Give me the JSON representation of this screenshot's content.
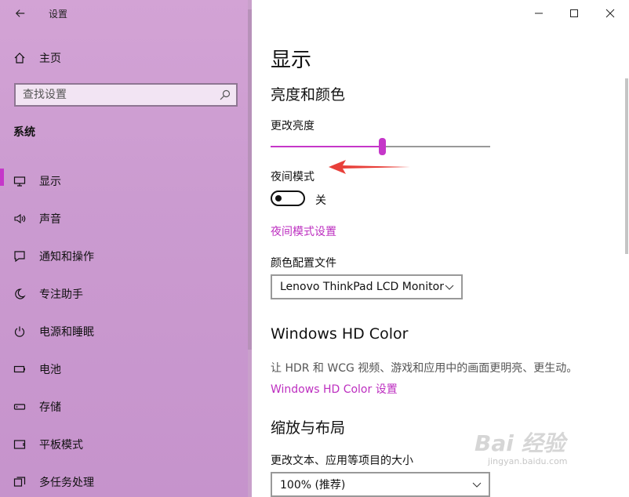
{
  "window": {
    "title": "设置"
  },
  "sidebar": {
    "home_label": "主页",
    "search_placeholder": "查找设置",
    "section_label": "系统",
    "items": [
      {
        "label": "显示",
        "icon": "monitor-icon",
        "active": true
      },
      {
        "label": "声音",
        "icon": "speaker-icon"
      },
      {
        "label": "通知和操作",
        "icon": "notification-icon"
      },
      {
        "label": "专注助手",
        "icon": "moon-icon"
      },
      {
        "label": "电源和睡眠",
        "icon": "power-icon"
      },
      {
        "label": "电池",
        "icon": "battery-icon"
      },
      {
        "label": "存储",
        "icon": "storage-icon"
      },
      {
        "label": "平板模式",
        "icon": "tablet-icon"
      },
      {
        "label": "多任务处理",
        "icon": "multitask-icon"
      }
    ]
  },
  "main": {
    "page_title": "显示",
    "brightness_section": "亮度和颜色",
    "brightness_label": "更改亮度",
    "brightness_level": 0.5,
    "night_light_label": "夜间模式",
    "night_light_state": "关",
    "night_light_settings_link": "夜间模式设置",
    "color_profile_label": "颜色配置文件",
    "color_profile_value": "Lenovo ThinkPad LCD Monitor",
    "hdr_section": "Windows HD Color",
    "hdr_description": "让 HDR 和 WCG 视频、游戏和应用中的画面更明亮、更生动。",
    "hdr_settings_link": "Windows HD Color 设置",
    "scale_section": "缩放与布局",
    "scale_label": "更改文本、应用等项目的大小",
    "scale_value": "100% (推荐)"
  },
  "watermark": {
    "brand": "Bai 经验",
    "url": "jingyan.baidu.com"
  },
  "colors": {
    "accent": "#c537c9",
    "link": "#bd2fc0",
    "sidebar": "#cb9bd0",
    "annotation_arrow": "#e8403a"
  }
}
